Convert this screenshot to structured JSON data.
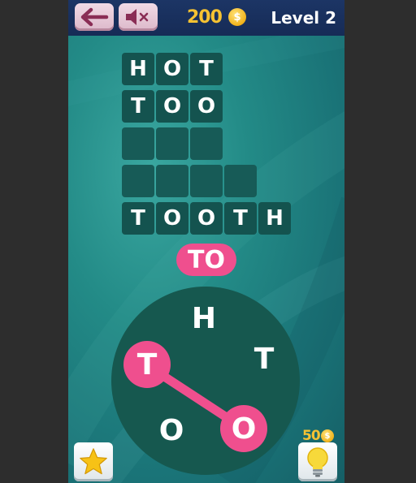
{
  "header": {
    "coins": "200",
    "coin_symbol": "$",
    "level": "Level 2"
  },
  "board": {
    "rows": [
      [
        "H",
        "O",
        "T"
      ],
      [
        "T",
        "O",
        "O"
      ],
      [
        "",
        "",
        ""
      ],
      [
        "",
        "",
        "",
        ""
      ],
      [
        "T",
        "O",
        "O",
        "T",
        "H"
      ]
    ]
  },
  "current_word": "TO",
  "wheel": {
    "letters": [
      "H",
      "T",
      "O",
      "O",
      "T"
    ],
    "selected_order": [
      "T",
      "O"
    ]
  },
  "hint": {
    "cost": "50",
    "coin_symbol": "$"
  },
  "colors": {
    "accent_pink": "#ef4f8e",
    "tile": "#14534f",
    "coin_gold": "#f6c232",
    "top_bar": "#1c3565"
  },
  "icons": {
    "back": "back-arrow-icon",
    "mute": "speaker-muted-icon",
    "coin": "coin-icon",
    "star": "star-icon",
    "hint": "lightbulb-icon"
  }
}
